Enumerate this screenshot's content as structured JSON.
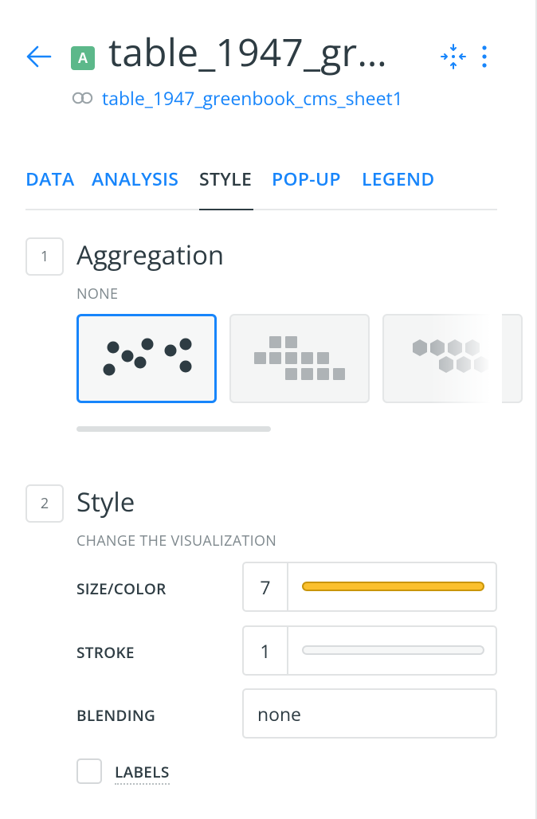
{
  "header": {
    "back_icon": "arrow-left-icon",
    "layer_badge": "A",
    "title": "table_1947_gr…",
    "source_icon": "dataset-link-icon",
    "source_name": "table_1947_greenbook_cms_sheet1",
    "zoom_icon": "zoom-to-layer-icon",
    "more_icon": "more-vertical-icon"
  },
  "tabs": [
    {
      "label": "DATA",
      "active": false
    },
    {
      "label": "ANALYSIS",
      "active": false
    },
    {
      "label": "STYLE",
      "active": true
    },
    {
      "label": "POP-UP",
      "active": false
    },
    {
      "label": "LEGEND",
      "active": false
    }
  ],
  "aggregation": {
    "step": "1",
    "title": "Aggregation",
    "subtitle": "NONE",
    "options": [
      {
        "type": "points",
        "selected": true
      },
      {
        "type": "squares",
        "selected": false
      },
      {
        "type": "hexabins",
        "selected": false
      }
    ]
  },
  "style": {
    "step": "2",
    "title": "Style",
    "subtitle": "CHANGE THE VISUALIZATION",
    "size_color": {
      "label": "SIZE/COLOR",
      "value": "7",
      "color": "#fbc02d"
    },
    "stroke": {
      "label": "STROKE",
      "value": "1"
    },
    "blending": {
      "label": "BLENDING",
      "value": "none"
    },
    "labels": {
      "label": "LABELS",
      "checked": false
    }
  },
  "colors": {
    "accent": "#1785fb",
    "badge": "#5cb88a",
    "fill": "#fbc02d"
  }
}
